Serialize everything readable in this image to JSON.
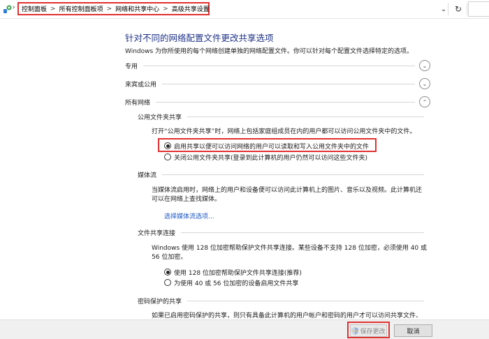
{
  "address_bar": {
    "breadcrumbs": [
      "控制面板",
      "所有控制面板项",
      "网络和共享中心",
      "高级共享设置"
    ],
    "separator": ">"
  },
  "page": {
    "title": "针对不同的网络配置文件更改共享选项",
    "description": "Windows 为你所使用的每个网络创建单独的网络配置文件。你可以针对每个配置文件选择特定的选项。"
  },
  "profiles": [
    {
      "label": "专用",
      "expanded": false
    },
    {
      "label": "来宾或公用",
      "expanded": false
    },
    {
      "label": "所有网络",
      "expanded": true
    }
  ],
  "public_folder": {
    "heading": "公用文件夹共享",
    "text": "打开“公用文件夹共享”时，网络上包括家庭组成员在内的用户都可以访问公用文件夹中的文件。",
    "options": [
      {
        "label": "启用共享以便可以访问网络的用户可以读取和写入公用文件夹中的文件",
        "selected": true
      },
      {
        "label": "关闭公用文件夹共享(登录到此计算机的用户仍然可以访问这些文件夹)",
        "selected": false
      }
    ]
  },
  "media_streaming": {
    "heading": "媒体流",
    "text_line1": "当媒体流启用时，网络上的用户和设备便可以访问此计算机上的图片、音乐以及视频。此计算机还",
    "text_line2": "可以在网络上查找媒体。",
    "link": "选择媒体流选项..."
  },
  "file_sharing": {
    "heading": "文件共享连接",
    "text_line1": "Windows 使用 128 位加密帮助保护文件共享连接。某些设备不支持 128 位加密，必须使用 40 或",
    "text_line2": "56 位加密。",
    "options": [
      {
        "label": "使用 128 位加密帮助保护文件共享连接(推荐)",
        "selected": true
      },
      {
        "label": "为使用 40 或 56 位加密的设备启用文件共享",
        "selected": false
      }
    ]
  },
  "password_protection": {
    "heading": "密码保护的共享",
    "text": "如果已启用密码保护的共享，则只有具备此计算机的用户帐户和密码的用户才可以访问共享文件、"
  },
  "footer": {
    "save_label": "保存更改",
    "cancel_label": "取消"
  },
  "colors": {
    "title": "#1e3287",
    "link": "#1a56c4",
    "annotation": "#e03030"
  }
}
